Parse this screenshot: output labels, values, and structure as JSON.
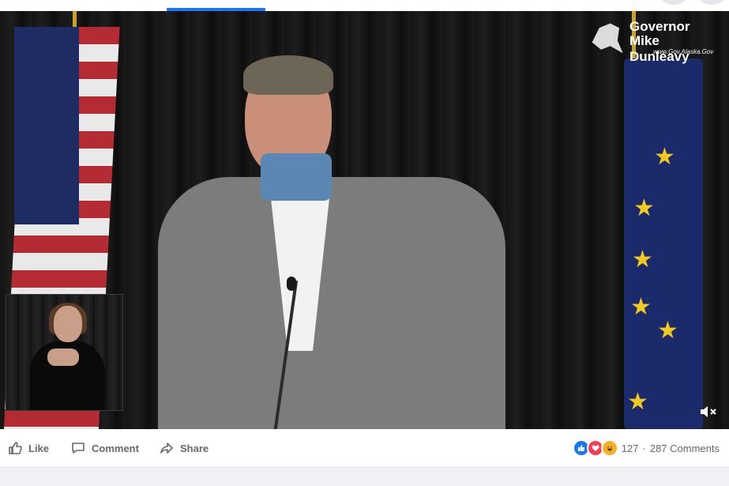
{
  "video": {
    "watermark": {
      "line1": "Governor",
      "line2": "Mike Dunleavy",
      "url": "www.Gov.Alaska.Gov"
    },
    "mute_icon": "muted-speaker-icon"
  },
  "actions": {
    "like": {
      "label": "Like",
      "icon": "thumbs-up-icon"
    },
    "comment": {
      "label": "Comment",
      "icon": "comment-bubble-icon"
    },
    "share": {
      "label": "Share",
      "icon": "share-arrow-icon"
    }
  },
  "reactions": {
    "icons": [
      "like-reaction-icon",
      "love-reaction-icon",
      "haha-reaction-icon"
    ],
    "count": "127",
    "separator": "·",
    "comments": "287 Comments"
  },
  "colors": {
    "accent": "#1877f2",
    "love": "#f33e58",
    "haha": "#f7b125",
    "text_secondary": "#65676b"
  }
}
